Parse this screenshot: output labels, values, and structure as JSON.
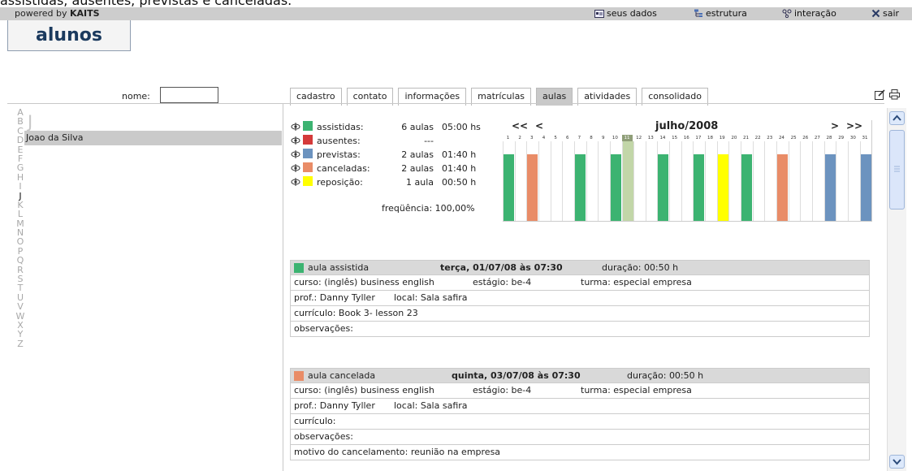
{
  "caption": "assistidas, ausentes, previstas e canceladas.",
  "header": {
    "powered_prefix": "powered by ",
    "powered_brand": "KAITS",
    "nav": [
      "seus dados",
      "estrutura",
      "interação",
      "sair"
    ]
  },
  "page_title": "alunos",
  "search": {
    "label": "nome:",
    "value": ""
  },
  "tabs": [
    "cadastro",
    "contato",
    "informações",
    "matrículas",
    "aulas",
    "atividades",
    "consolidado"
  ],
  "active_tab": "aulas",
  "alphabet": [
    "A",
    "B",
    "C",
    "D",
    "E",
    "F",
    "G",
    "H",
    "I",
    "J",
    "K",
    "L",
    "M",
    "N",
    "O",
    "P",
    "Q",
    "R",
    "S",
    "T",
    "U",
    "V",
    "W",
    "X",
    "Y",
    "Z"
  ],
  "selected_letter": "J",
  "group_letter": "J",
  "student": "Joao da Silva",
  "summary": [
    {
      "label": "assistidas:",
      "count": "6 aulas",
      "time": "05:00 hs",
      "color": "#3cb371"
    },
    {
      "label": "ausentes:",
      "count": "---",
      "time": "",
      "color": "#d43a3a"
    },
    {
      "label": "previstas:",
      "count": "2 aulas",
      "time": "01:40 h",
      "color": "#6c93bf"
    },
    {
      "label": "canceladas:",
      "count": "2 aulas",
      "time": "01:40 h",
      "color": "#e98c67"
    },
    {
      "label": "reposição:",
      "count": "1 aula",
      "time": "00:50 h",
      "color": "#ffff00"
    }
  ],
  "frequency": "freqüência: 100,00%",
  "calendar": {
    "month": "julho/2008",
    "prev_year": "<<",
    "prev": "<",
    "next": ">",
    "next_year": ">>",
    "days": [
      "1",
      "2",
      "3",
      "4",
      "5",
      "6",
      "7",
      "8",
      "9",
      "10",
      "11",
      "12",
      "13",
      "14",
      "15",
      "16",
      "17",
      "18",
      "19",
      "20",
      "21",
      "22",
      "23",
      "24",
      "25",
      "26",
      "27",
      "28",
      "29",
      "30",
      "31"
    ],
    "today": "11",
    "marks": [
      {
        "day": 1,
        "status": "assistida"
      },
      {
        "day": 3,
        "status": "cancelada"
      },
      {
        "day": 7,
        "status": "assistida"
      },
      {
        "day": 10,
        "status": "assistida"
      },
      {
        "day": 11,
        "status": "hoje"
      },
      {
        "day": 14,
        "status": "assistida"
      },
      {
        "day": 17,
        "status": "assistida"
      },
      {
        "day": 19,
        "status": "reposição"
      },
      {
        "day": 21,
        "status": "assistida"
      },
      {
        "day": 24,
        "status": "cancelada"
      },
      {
        "day": 28,
        "status": "prevista"
      },
      {
        "day": 31,
        "status": "prevista"
      }
    ],
    "colors": {
      "assistida": "#3cb371",
      "cancelada": "#e98c67",
      "prevista": "#6c93bf",
      "reposição": "#ffff00",
      "hoje": "#c2d6a8"
    }
  },
  "cards": [
    {
      "status": "aula assistida",
      "color": "#3cb371",
      "date": "terça, 01/07/08 às 07:30",
      "duration": "duração: 00:50 h",
      "curso": "curso: (inglês) business english",
      "estagio": "estágio: be-4",
      "turma": "turma: especial empresa",
      "prof": "prof.: Danny Tyller",
      "local": "local: Sala safira",
      "curriculo": "currículo: Book 3- lesson 23",
      "observacoes": "observações:",
      "motivo": ""
    },
    {
      "status": "aula cancelada",
      "color": "#e98c67",
      "date": "quinta, 03/07/08 às 07:30",
      "duration": "duração: 00:50 h",
      "curso": "curso: (inglês) business english",
      "estagio": "estágio: be-4",
      "turma": "turma: especial empresa",
      "prof": "prof.: Danny Tyller",
      "local": "local: Sala safira",
      "curriculo": "currículo:",
      "observacoes": "observações:",
      "motivo": "motivo do cancelamento: reunião na empresa"
    }
  ]
}
